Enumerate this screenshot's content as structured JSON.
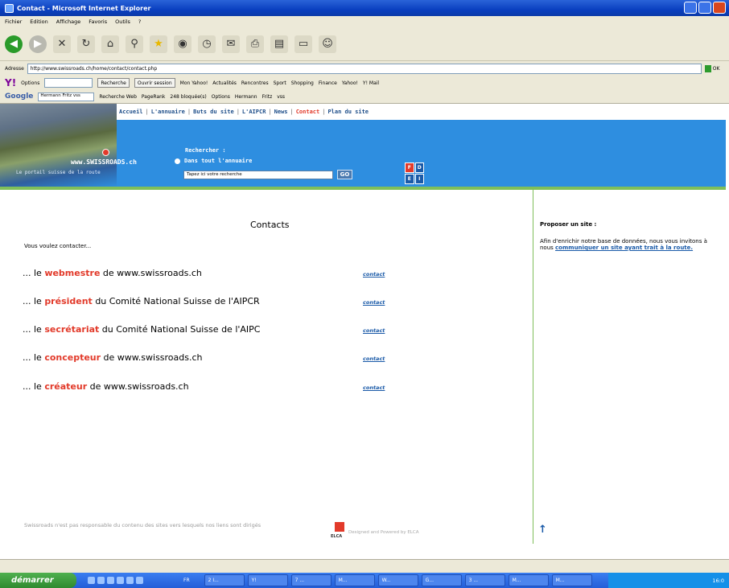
{
  "window": {
    "title": "Contact - Microsoft Internet Explorer"
  },
  "menu": [
    "Fichier",
    "Edition",
    "Affichage",
    "Favoris",
    "Outils",
    "?"
  ],
  "address": {
    "label": "Adresse",
    "url": "http://www.swissroads.ch/home/contact/contact.php",
    "go": "OK"
  },
  "yahoo_bar": {
    "logo": "Y!",
    "options": "Options",
    "search_button": "Recherche",
    "items": [
      "Ouvrir session",
      "Mon Yahoo!",
      "Actualités",
      "Rencontres",
      "Sport",
      "Shopping",
      "Finance",
      "Yahoo!",
      "Y! Mail"
    ]
  },
  "google_bar": {
    "logo": "Google",
    "query": "Hermann Fritz vss",
    "items": [
      "Recherche Web",
      "PageRank",
      "248 bloquée(s)",
      "Options",
      "Hermann",
      "Fritz",
      "vss"
    ]
  },
  "nav": {
    "items": [
      "Accueil",
      "L'annuaire",
      "Buts du site",
      "L'AIPCR",
      "News",
      "Contact",
      "Plan du site"
    ],
    "active": "Contact"
  },
  "brand": {
    "name": "www.SWISSROADS.ch",
    "tagline": "Le portail suisse de la route"
  },
  "search": {
    "title": "Rechercher :",
    "option": "Dans tout l'annuaire",
    "placeholder": "Tapez ici votre recherche",
    "go": "GO",
    "langs": [
      "F",
      "D",
      "E",
      "I"
    ]
  },
  "content": {
    "title": "Contacts",
    "intro": "Vous voulez contacter...",
    "rows": [
      {
        "pre": "... le ",
        "highlight": "webmestre",
        "post": " de www.swissroads.ch",
        "link": "contact"
      },
      {
        "pre": "... le ",
        "highlight": "président",
        "post": " du Comité National Suisse de l'AIPCR",
        "link": "contact"
      },
      {
        "pre": "... le ",
        "highlight": "secrétariat",
        "post": " du Comité National Suisse de l'AIPC",
        "link": "contact"
      },
      {
        "pre": "... le ",
        "highlight": "concepteur",
        "post": " de www.swissroads.ch",
        "link": "contact"
      },
      {
        "pre": "... le ",
        "highlight": "créateur",
        "post": " de www.swissroads.ch",
        "link": "contact"
      }
    ]
  },
  "sidebar": {
    "title": "Proposer un site :",
    "text": "Afin d'enrichir notre base de données, nous vous invitons à nous ",
    "link": "communiquer un site ayant trait à la route."
  },
  "footer": {
    "disclaimer": "Swissroads n'est pas responsable du contenu des sites vers lesquels nos liens sont dirigés",
    "logo": "ELCA",
    "credit": "Designed and Powered by ELCA"
  },
  "taskbar": {
    "start": "démarrer",
    "lang": "FR",
    "tasks": [
      "2 I...",
      "Y!",
      "7 ...",
      "M...",
      "W...",
      "G...",
      "3 ...",
      "M...",
      "M..."
    ],
    "clock": "16:0"
  }
}
